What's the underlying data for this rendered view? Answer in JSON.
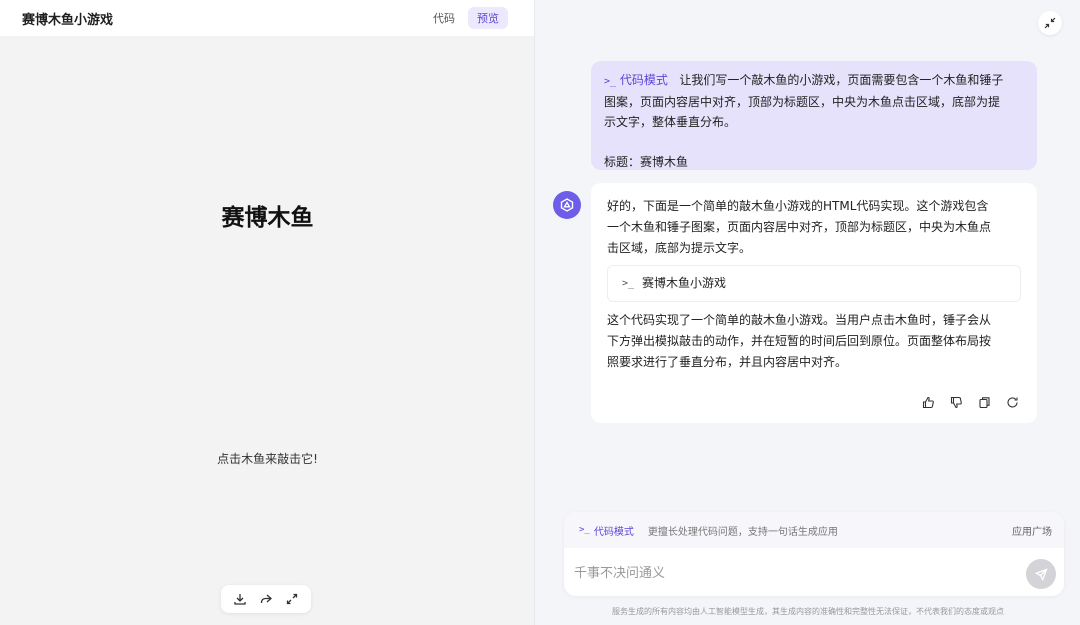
{
  "preview": {
    "header_title": "赛博木鱼小游戏",
    "tabs": [
      {
        "label": "代码",
        "active": false
      },
      {
        "label": "预览",
        "active": true
      }
    ],
    "game_title": "赛博木鱼",
    "game_hint": "点击木鱼来敲击它!",
    "toolbar_icons": [
      "download-icon",
      "share-icon",
      "fullscreen-icon"
    ]
  },
  "chat": {
    "user_message": {
      "mode_tag": "代码模式",
      "line1": "让我们写一个敲木鱼的小游戏，页面需要包含一个木鱼和锤子",
      "line2": "图案，页面内容居中对齐，顶部为标题区，中央为木鱼点击区域，底部为提",
      "line3": "示文字，整体垂直分布。",
      "line4": "标题：赛博木鱼"
    },
    "bot_message": {
      "para1_line1": "好的，下面是一个简单的敲木鱼小游戏的HTML代码实现。这个游戏包含",
      "para1_line2": "一个木鱼和锤子图案，页面内容居中对齐，顶部为标题区，中央为木鱼点",
      "para1_line3": "击区域，底部为提示文字。",
      "code_card_label": "赛博木鱼小游戏",
      "para2_line1": "这个代码实现了一个简单的敲木鱼小游戏。当用户点击木鱼时，锤子会从",
      "para2_line2": "下方弹出模拟敲击的动作，并在短暂的时间后回到原位。页面整体布局按",
      "para2_line3": "照要求进行了垂直分布，并且内容居中对齐。",
      "action_icons": [
        "thumbs-up-icon",
        "thumbs-down-icon",
        "copy-icon",
        "regenerate-icon"
      ]
    }
  },
  "input": {
    "mode_chip": "代码模式",
    "mode_desc": "更擅长处理代码问题，支持一句话生成应用",
    "app_square": "应用广场",
    "placeholder": "千事不决问通义",
    "disclaimer": "服务生成的所有内容均由人工智能模型生成，其生成内容的准确性和完整性无法保证，不代表我们的态度或观点"
  },
  "colors": {
    "accent": "#5b46d6",
    "user_bubble": "#e6e2fb",
    "avatar": "#6d5de8"
  }
}
